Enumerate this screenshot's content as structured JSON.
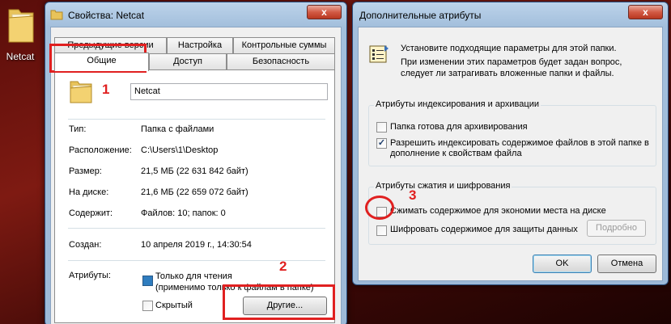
{
  "desktop": {
    "icon_label": "Netcat"
  },
  "props_window": {
    "title": "Свойства: Netcat",
    "close": "x",
    "tabs_row1": [
      "Предыдущие версии",
      "Настройка",
      "Контрольные суммы"
    ],
    "tabs_row2": [
      "Общие",
      "Доступ",
      "Безопасность"
    ],
    "folder_name": "Netcat",
    "fields": [
      {
        "label": "Тип:",
        "value": "Папка с файлами"
      },
      {
        "label": "Расположение:",
        "value": "C:\\Users\\1\\Desktop"
      },
      {
        "label": "Размер:",
        "value": "21,5 МБ (22 631 842 байт)"
      },
      {
        "label": "На диске:",
        "value": "21,6 МБ (22 659 072 байт)"
      },
      {
        "label": "Содержит:",
        "value": "Файлов: 10; папок: 0"
      },
      {
        "label": "Создан:",
        "value": "10 апреля 2019 г., 14:30:54"
      }
    ],
    "attributes_label": "Атрибуты:",
    "readonly_label": "Только для чтения",
    "readonly_note": "(применимо только к файлам в папке)",
    "hidden_label": "Скрытый",
    "other_button": "Другие..."
  },
  "attr_window": {
    "title": "Дополнительные атрибуты",
    "close": "x",
    "intro_line1": "Установите подходящие параметры для этой папки.",
    "intro_line2": "При изменении этих параметров будет задан вопрос,",
    "intro_line3": "следует ли затрагивать вложенные папки и файлы.",
    "index_group": {
      "title": "Атрибуты индексирования и архивации",
      "archive": "Папка готова для архивирования",
      "index_line1": "Разрешить индексировать содержимое файлов в этой папке в",
      "index_line2": "дополнение к свойствам файла"
    },
    "compress_group": {
      "title": "Атрибуты сжатия и шифрования",
      "compress": "Сжимать содержимое для экономии места на диске",
      "encrypt": "Шифровать содержимое для защиты данных",
      "details_button": "Подробно"
    },
    "ok_button": "OK",
    "cancel_button": "Отмена"
  },
  "annotations": {
    "n1": "1",
    "n2": "2",
    "n3": "3"
  }
}
